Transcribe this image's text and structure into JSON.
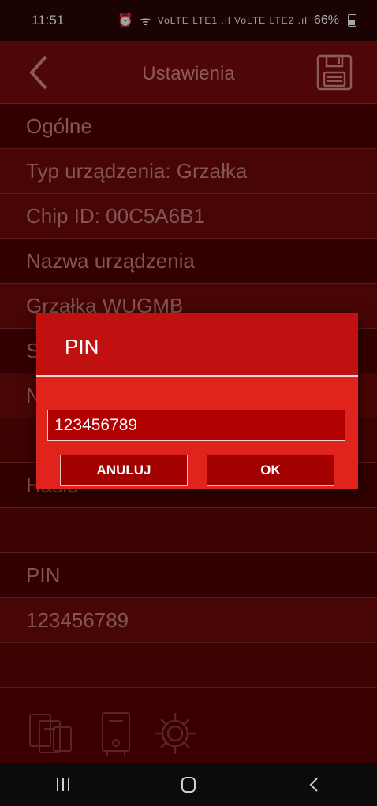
{
  "status": {
    "time": "11:51",
    "icons": "VoLTE LTE1 .ıl VoLTE LTE2 .ıl",
    "battery": "66%"
  },
  "header": {
    "title": "Ustawienia",
    "back_icon": "chevron-left-icon",
    "save_icon": "save-icon"
  },
  "rows": [
    {
      "text": "Ogólne",
      "kind": "header"
    },
    {
      "text": "Typ urządzenia: Grzałka",
      "kind": "item"
    },
    {
      "text": "Chip ID: 00C5A6B1",
      "kind": "item"
    },
    {
      "text": "Nazwa urządzenia",
      "kind": "header"
    },
    {
      "text": "Grzałka WUGMB",
      "kind": "item"
    },
    {
      "text": "S",
      "kind": "header"
    },
    {
      "text": "N",
      "kind": "item"
    },
    {
      "text": "",
      "kind": "empty"
    },
    {
      "text": "Hasło",
      "kind": "header"
    },
    {
      "text": "",
      "kind": "empty"
    },
    {
      "text": "PIN",
      "kind": "header"
    },
    {
      "text": "123456789",
      "kind": "item"
    },
    {
      "text": "",
      "kind": "empty"
    }
  ],
  "dialog": {
    "title": "PIN",
    "input_value": "123456789",
    "cancel_label": "ANULUJ",
    "ok_label": "OK"
  },
  "bottom_nav": [
    "devices-icon",
    "boiler-icon",
    "settings-gear-icon"
  ],
  "colors": {
    "background": "#5a0000",
    "dialog": "#e0231c",
    "dialog_header": "#c01010",
    "button": "#a30000",
    "text_muted": "#c98282"
  }
}
